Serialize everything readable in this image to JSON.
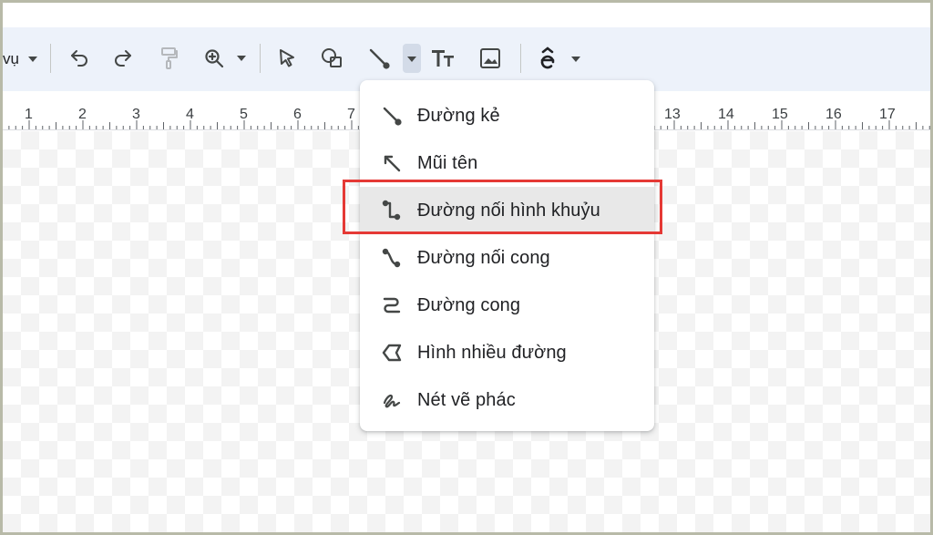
{
  "toolbar": {
    "menu_label": "vụ",
    "icons": [
      "dropdown-caret",
      "undo",
      "redo",
      "paint-format",
      "zoom",
      "select",
      "shape",
      "line",
      "text-style",
      "image",
      "extension"
    ]
  },
  "ruler": {
    "numbers": [
      "1",
      "2",
      "3",
      "4",
      "5",
      "6",
      "7",
      "13",
      "14",
      "15",
      "16",
      "17"
    ]
  },
  "line_menu": {
    "items": [
      {
        "label": "Đường kẻ",
        "icon": "line-icon"
      },
      {
        "label": "Mũi tên",
        "icon": "arrow-icon"
      },
      {
        "label": "Đường nối hình khuỷu",
        "icon": "elbow-connector-icon",
        "selected": true
      },
      {
        "label": "Đường nối cong",
        "icon": "curved-connector-icon"
      },
      {
        "label": "Đường cong",
        "icon": "curve-icon"
      },
      {
        "label": "Hình nhiều đường",
        "icon": "polyline-icon"
      },
      {
        "label": "Nét vẽ phác",
        "icon": "scribble-icon"
      }
    ]
  },
  "colors": {
    "toolbar_bg": "#edf2fa",
    "highlight": "#e53935",
    "frame": "#b8baa8"
  }
}
